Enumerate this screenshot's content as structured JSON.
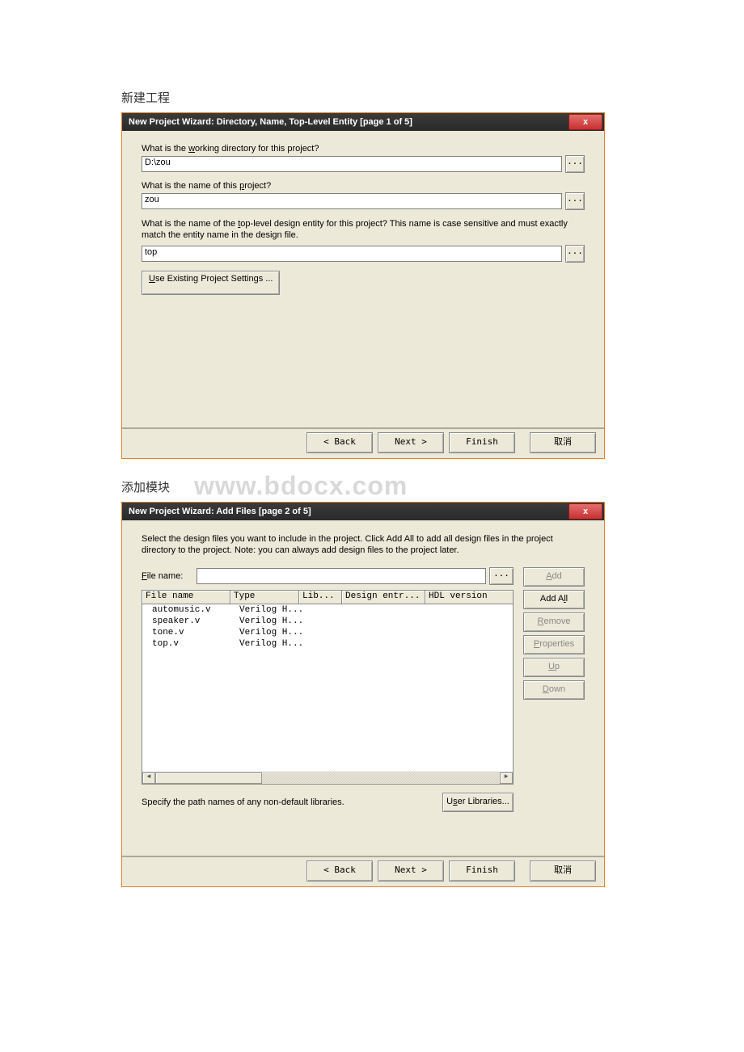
{
  "headings": {
    "create_project": "新建工程",
    "add_module": "添加模块"
  },
  "watermark": "www.bdocx.com",
  "dialog1": {
    "title": "New Project Wizard: Directory, Name, Top-Level Entity [page 1 of 5]",
    "close_icon": "x",
    "q1": "What is the ",
    "q1_u": "w",
    "q1_rest": "orking directory for this project?",
    "dir_value": "D:\\zou",
    "q2_pre": "What is the name of this ",
    "q2_u": "p",
    "q2_rest": "roject?",
    "name_value": "zou",
    "q3_pre": "What is the name of the ",
    "q3_u": "t",
    "q3_rest": "op-level design entity for this project? This name is case sensitive and must exactly match the entity name in the design file.",
    "entity_value": "top",
    "existing_btn_u": "U",
    "existing_btn_rest": "se Existing Project Settings ...",
    "browse": "...",
    "back": "< Back",
    "next": "Next >",
    "finish": "Finish",
    "cancel": "取消"
  },
  "dialog2": {
    "title": "New Project Wizard: Add Files [page 2 of 5]",
    "close_icon": "x",
    "desc": "Select the design files you want to include in the project. Click Add All to add all design files in the project directory to the project. Note: you can always add design files to the project later.",
    "filename_label_u": "F",
    "filename_label_rest": "ile name:",
    "browse": "...",
    "add_u": "A",
    "add_rest": "dd",
    "addall_pre": "Add A",
    "addall_u": "l",
    "addall_rest": "l",
    "remove_u": "R",
    "remove_rest": "emove",
    "props_u": "P",
    "props_rest": "roperties",
    "up_u": "U",
    "up_rest": "p",
    "down_u": "D",
    "down_rest": "own",
    "cols": {
      "fn": "File name",
      "type": "Type",
      "lib": "Lib...",
      "des": "Design entr...",
      "hdl": "HDL version"
    },
    "rows": [
      {
        "fn": "automusic.v",
        "type": "Verilog H..."
      },
      {
        "fn": "speaker.v",
        "type": "Verilog H..."
      },
      {
        "fn": "tone.v",
        "type": "Verilog H..."
      },
      {
        "fn": "top.v",
        "type": "Verilog H..."
      }
    ],
    "lib_note": "Specify the path names of any non-default libraries.",
    "userlib_pre": "U",
    "userlib_u": "s",
    "userlib_rest": "er Libraries...",
    "back": "< Back",
    "next": "Next >",
    "finish": "Finish",
    "cancel": "取消"
  }
}
